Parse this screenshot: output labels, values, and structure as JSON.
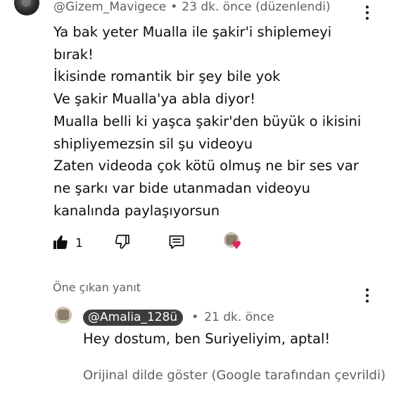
{
  "comment": {
    "handle": "@Gizem_Mavigece",
    "separator": "•",
    "time": "23 dk. önce (düzenlendi)",
    "lines": [
      "Ya bak yeter Mualla ile şakir'i shiplemeyi",
      "bırak!",
      "İkisinde romantik bir şey bile yok",
      "Ve şakir Mualla'ya abla diyor!",
      "Mualla belli ki yaşca şakir'den büyük o ikisini",
      "shipliyemezsin sil şu videoyu",
      "Zaten videoda çok kötü olmuş ne bir ses var",
      "ne şarkı var bide utanmadan videoyu",
      "kanalında paylaşıyorsun"
    ],
    "like_count": "1",
    "icons": {
      "avatar": "user-avatar",
      "like": "thumbs-up-filled-icon",
      "dislike": "thumbs-down-icon",
      "reply": "reply-comment-icon",
      "creator_heart": "creator-heart-icon",
      "menu": "more-vert-icon"
    }
  },
  "featured_reply": {
    "label": "Öne çıkan yanıt",
    "channel": "@Amalia_128ü",
    "separator": "•",
    "time": "21 dk. önce",
    "text": "Hey dostum, ben Suriyeliyim, aptal!",
    "translate_link": "Orijinal dilde göster (Google tarafından çevrildi)"
  },
  "colors": {
    "text": "#0f0f0f",
    "secondary": "#606060",
    "chip_bg": "#3d3d3d",
    "heart": "#e0245e"
  }
}
